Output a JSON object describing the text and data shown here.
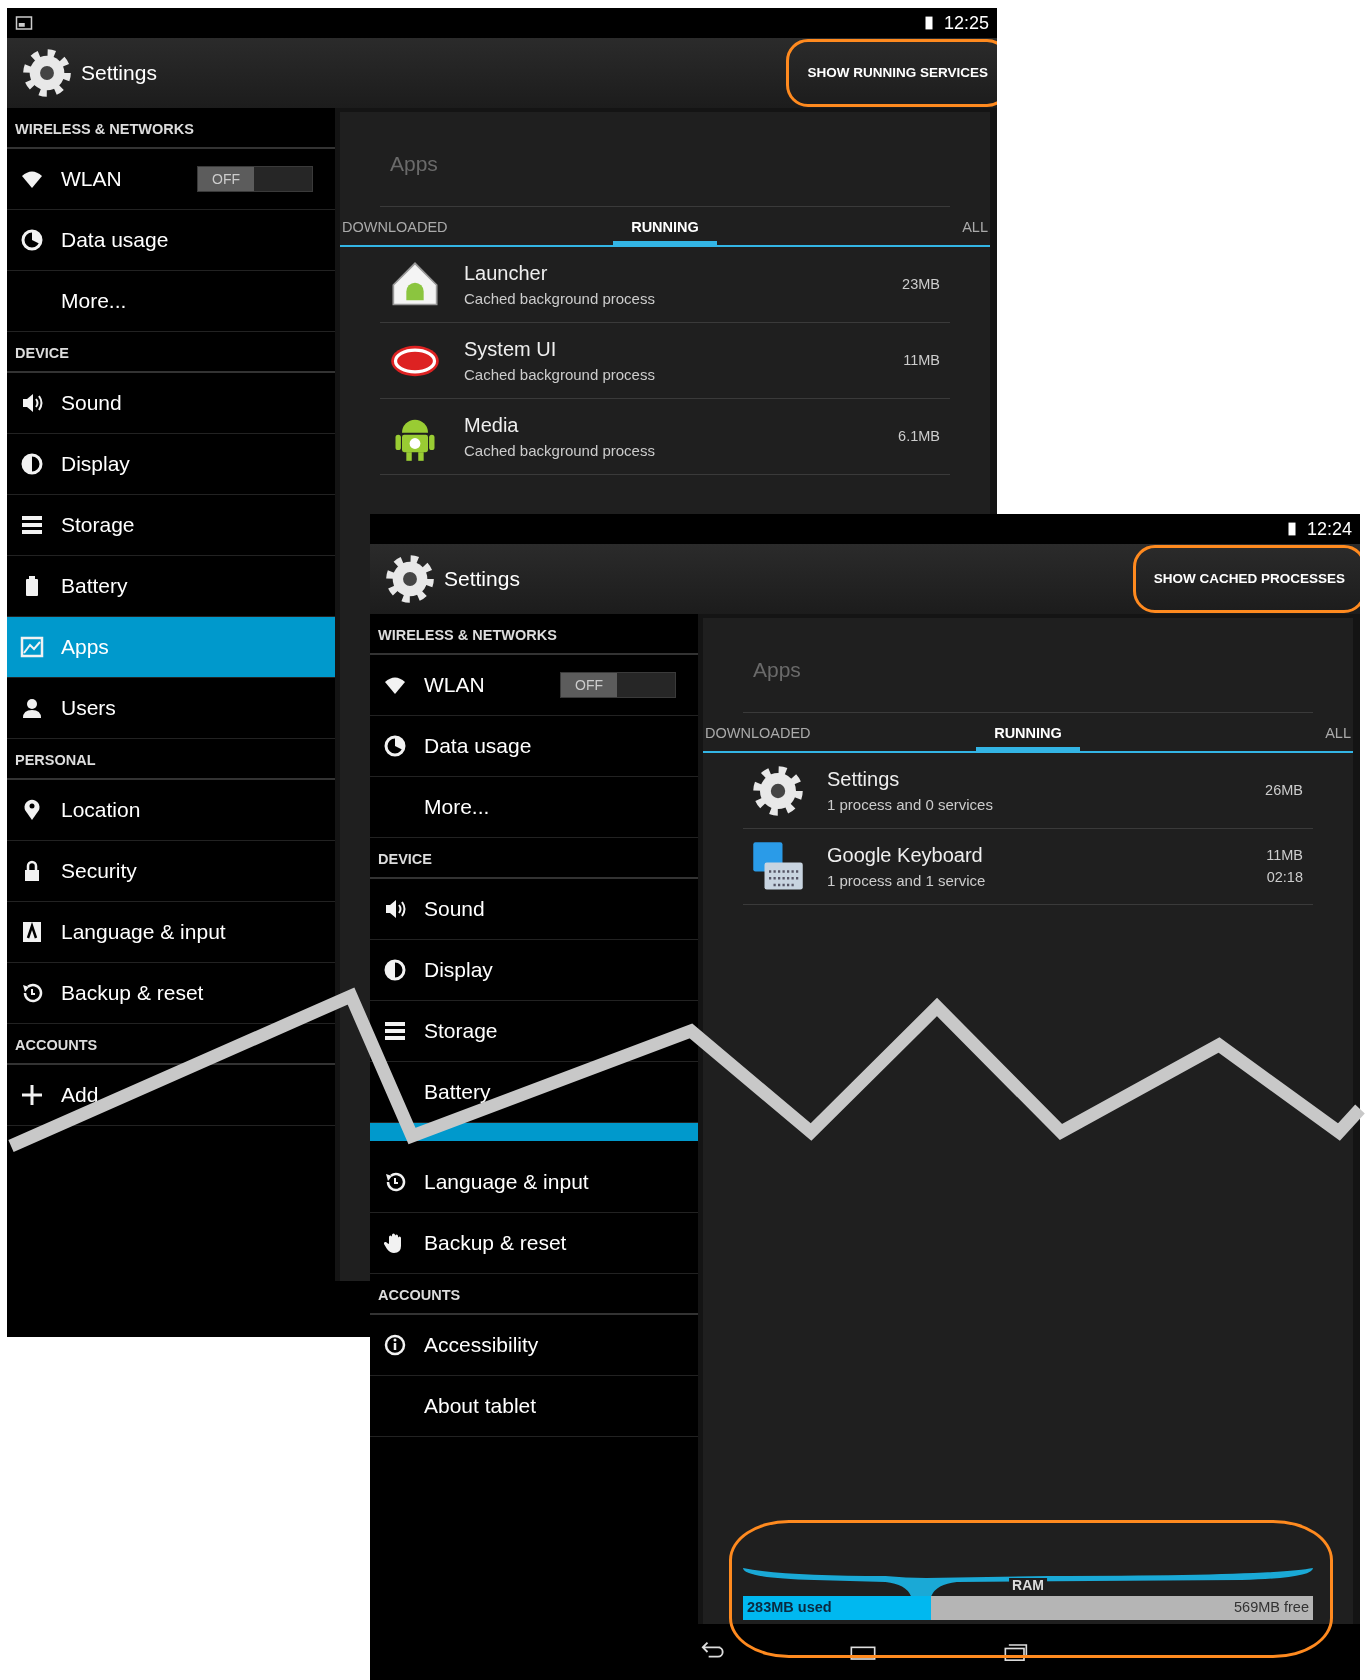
{
  "screens": [
    {
      "status_bar": {
        "time": "12:25",
        "notification_icon": true
      },
      "action_bar": {
        "title": "Settings",
        "action": "SHOW RUNNING SERVICES",
        "highlighted": true
      },
      "sidebar": [
        {
          "kind": "header",
          "label": "WIRELESS & NETWORKS"
        },
        {
          "kind": "item",
          "label": "WLAN",
          "selected": false,
          "toggle": {
            "label": "OFF",
            "on": false
          }
        },
        {
          "kind": "item",
          "label": "Data usage",
          "selected": false
        },
        {
          "kind": "item",
          "label": "More...",
          "selected": false
        },
        {
          "kind": "header",
          "label": "DEVICE"
        },
        {
          "kind": "item",
          "label": "Sound",
          "selected": false
        },
        {
          "kind": "item",
          "label": "Display",
          "selected": false
        },
        {
          "kind": "item",
          "label": "Storage",
          "selected": false
        },
        {
          "kind": "item",
          "label": "Battery",
          "selected": false
        },
        {
          "kind": "item",
          "label": "Apps",
          "selected": true
        },
        {
          "kind": "item",
          "label": "Users",
          "selected": false
        },
        {
          "kind": "header",
          "label": "PERSONAL"
        },
        {
          "kind": "item",
          "label": "Location",
          "selected": false
        },
        {
          "kind": "item",
          "label": "Security",
          "selected": false
        },
        {
          "kind": "item",
          "label": "Language & input",
          "selected": false
        },
        {
          "kind": "item",
          "label": "Backup & reset",
          "selected": false
        },
        {
          "kind": "header",
          "label": "ACCOUNTS"
        },
        {
          "kind": "item",
          "label": "Add",
          "selected": false
        }
      ],
      "content": {
        "title": "Apps",
        "tabs": [
          {
            "label": "DOWNLOADED",
            "selected": false
          },
          {
            "label": "RUNNING",
            "selected": true
          },
          {
            "label": "ALL",
            "selected": false
          }
        ],
        "apps": [
          {
            "name": "Launcher",
            "detail": "Cached background process",
            "size": "23MB"
          },
          {
            "name": "System UI",
            "detail": "Cached background process",
            "size": "11MB"
          },
          {
            "name": "Media",
            "detail": "Cached background process",
            "size": "6.1MB"
          }
        ]
      }
    },
    {
      "status_bar": {
        "time": "12:24",
        "notification_icon": false
      },
      "action_bar": {
        "title": "Settings",
        "action": "SHOW CACHED PROCESSES",
        "highlighted": true
      },
      "sidebar": [
        {
          "kind": "header",
          "label": "WIRELESS & NETWORKS"
        },
        {
          "kind": "item",
          "label": "WLAN",
          "selected": false,
          "toggle": {
            "label": "OFF",
            "on": false
          }
        },
        {
          "kind": "item",
          "label": "Data usage",
          "selected": false
        },
        {
          "kind": "item",
          "label": "More...",
          "selected": false
        },
        {
          "kind": "header",
          "label": "DEVICE"
        },
        {
          "kind": "item",
          "label": "Sound",
          "selected": false
        },
        {
          "kind": "item",
          "label": "Display",
          "selected": false
        },
        {
          "kind": "item",
          "label": "Storage",
          "selected": false
        },
        {
          "kind": "item",
          "label": "Battery",
          "selected": false
        },
        {
          "kind": "cut",
          "selected": true
        },
        {
          "kind": "item",
          "label": "Language & input",
          "selected": false
        },
        {
          "kind": "item",
          "label": "Backup & reset",
          "selected": false
        },
        {
          "kind": "header",
          "label": "ACCOUNTS"
        },
        {
          "kind": "item",
          "label": "Accessibility",
          "selected": false
        },
        {
          "kind": "item",
          "label": "About tablet",
          "selected": false
        }
      ],
      "content": {
        "title": "Apps",
        "tabs": [
          {
            "label": "DOWNLOADED",
            "selected": false
          },
          {
            "label": "RUNNING",
            "selected": true
          },
          {
            "label": "ALL",
            "selected": false
          }
        ],
        "apps": [
          {
            "name": "Settings",
            "detail": "1 process and 0 services",
            "size": "26MB"
          },
          {
            "name": "Google Keyboard",
            "detail": "1 process and 1 service",
            "size": "11MB",
            "time": "02:18"
          }
        ],
        "ram": {
          "label": "RAM",
          "used": "283MB used",
          "free": "569MB free",
          "level": 0.33,
          "highlighted": true
        }
      }
    }
  ]
}
